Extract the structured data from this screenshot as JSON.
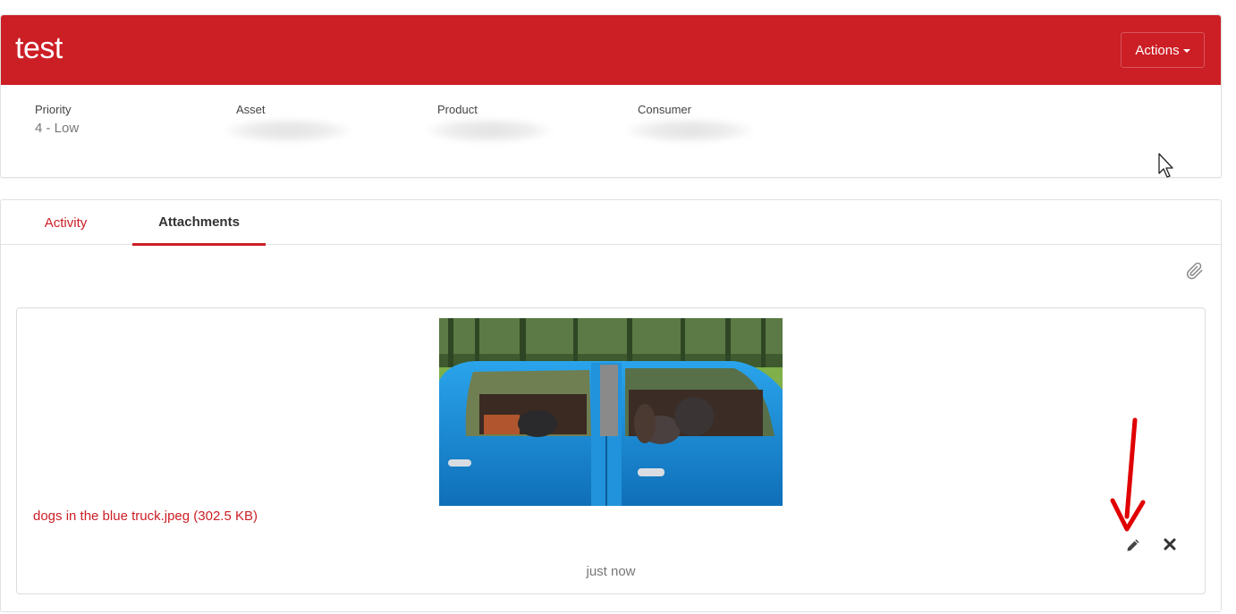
{
  "ticket": {
    "title": "test",
    "actions_label": "Actions",
    "fields": [
      {
        "label": "Priority",
        "value": "4 - Low"
      },
      {
        "label": "Asset",
        "value": ""
      },
      {
        "label": "Product",
        "value": ""
      },
      {
        "label": "Consumer",
        "value": ""
      }
    ]
  },
  "tabs": [
    {
      "label": "Activity",
      "active": false
    },
    {
      "label": "Attachments",
      "active": true
    }
  ],
  "attachment": {
    "link_text": "dogs in the blue truck.jpeg (302.5 KB)",
    "time": "just now"
  },
  "icons": {
    "paperclip": "paperclip-icon",
    "edit": "pencil-icon",
    "delete": "close-icon",
    "cursor": "mouse-cursor-icon",
    "annotation": "red-arrow-annotation"
  },
  "colors": {
    "brand": "#cc1e25",
    "muted_text": "#777777",
    "truck_blue": "#1a8fd6"
  }
}
